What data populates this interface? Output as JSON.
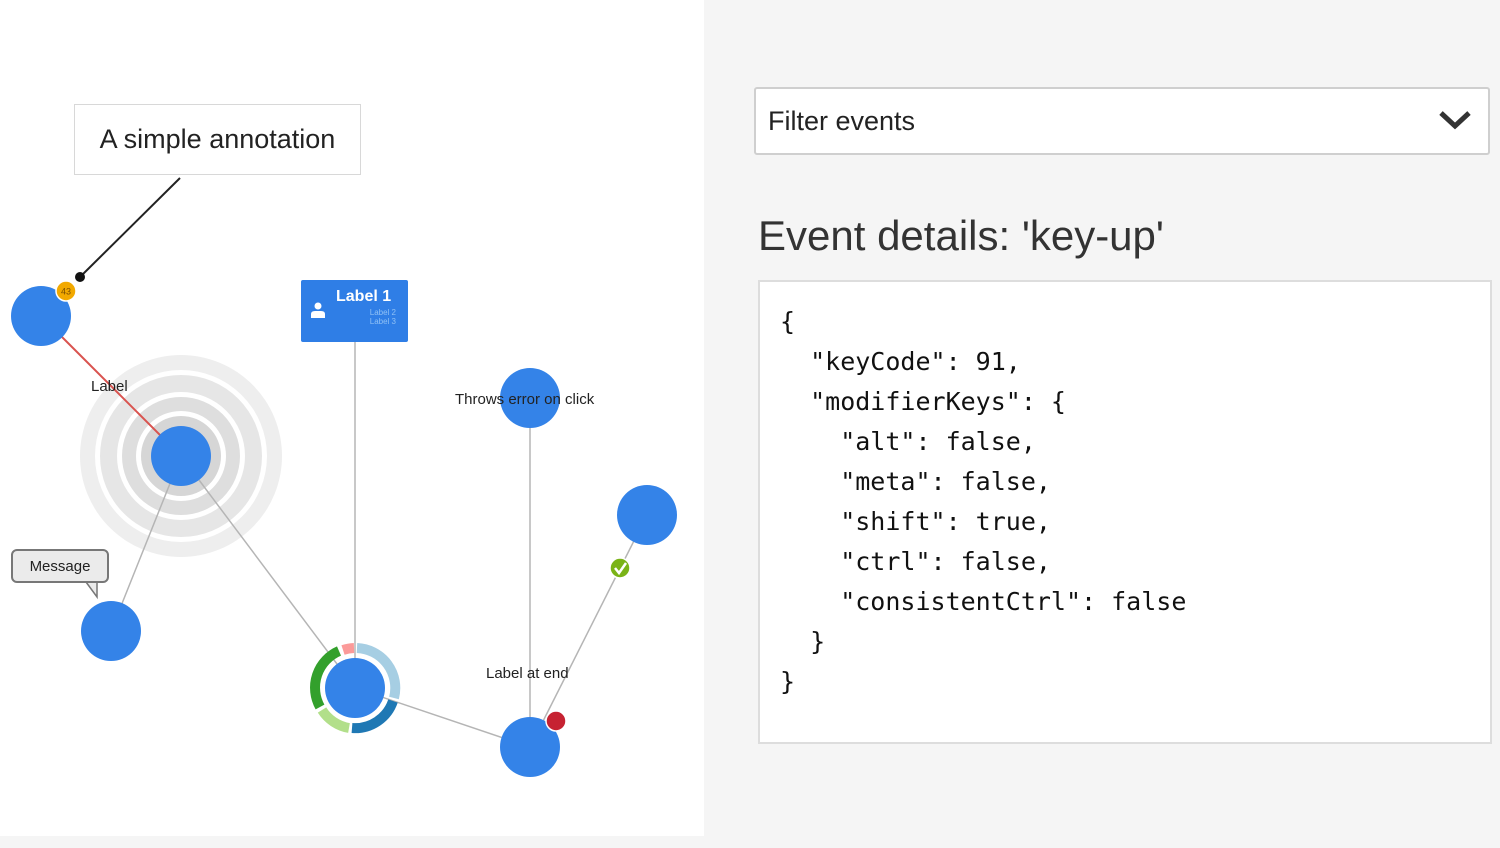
{
  "graph": {
    "annotation_text": "A simple annotation",
    "node_card": {
      "title": "Label 1",
      "subtitle_1": "Label 2",
      "subtitle_2": "Label 3"
    },
    "badge_count": "43",
    "edge_label": "Label",
    "error_node_label": "Throws error on click",
    "end_label": "Label at end",
    "tooltip_text": "Message",
    "colors": {
      "node": "#3483e8",
      "edge": "#b5b5b5",
      "highlight_edge": "#d9534f",
      "badge": "#f2a900",
      "status_ok": "#7ab317",
      "status_error": "#c62232",
      "card": "#2f7ee6"
    }
  },
  "sidebar": {
    "filter_placeholder": "Filter events",
    "event_heading": "Event details: 'key-up'",
    "event_json": "{\n  \"keyCode\": 91,\n  \"modifierKeys\": {\n    \"alt\": false,\n    \"meta\": false,\n    \"shift\": true,\n    \"ctrl\": false,\n    \"consistentCtrl\": false\n  }\n}"
  }
}
